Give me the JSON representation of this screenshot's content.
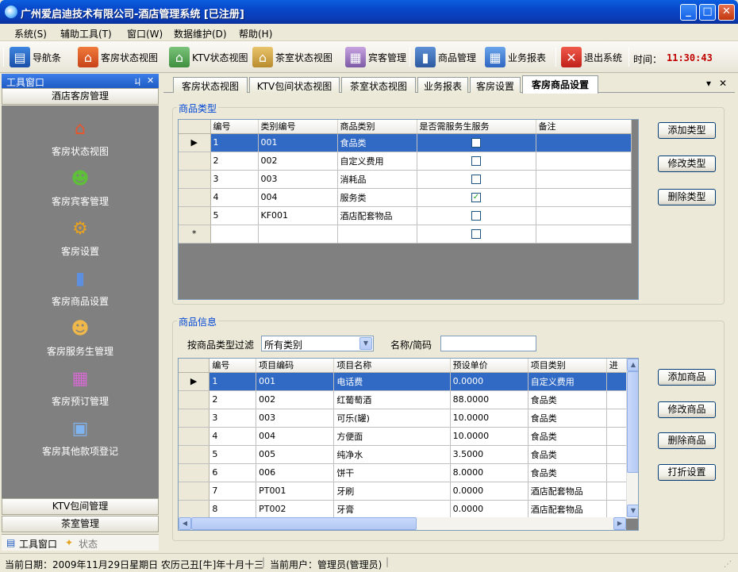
{
  "window": {
    "title": "广州爱启迪技术有限公司-酒店管理系统 [已注册]"
  },
  "menu": [
    "系统(S)",
    "辅助工具(T)",
    "窗口(W)",
    "数据维护(D)",
    "帮助(H)"
  ],
  "toolbar": {
    "items": [
      "导航条",
      "客房状态视图",
      "KTV状态视图",
      "茶室状态视图",
      "宾客管理",
      "商品管理",
      "业务报表",
      "退出系统"
    ],
    "time_label": "时间：",
    "time_value": "11:30:43"
  },
  "left_panel": {
    "title": "工具窗口",
    "pin": "ㄐ",
    "close": "✕",
    "section": "酒店客房管理",
    "nav_items": [
      "客房状态视图",
      "客房宾客管理",
      "客房设置",
      "客房商品设置",
      "客房服务生管理",
      "客房预订管理",
      "客房其他款项登记"
    ],
    "bottom_sections": [
      "KTV包间管理",
      "茶室管理"
    ],
    "bottom_tabs": [
      "工具窗口",
      "状态"
    ]
  },
  "tabs": [
    "客房状态视图",
    "KTV包间状态视图",
    "茶室状态视图",
    "业务报表",
    "客房设置",
    "客房商品设置"
  ],
  "tab_controls": {
    "dropdown": "▾",
    "close": "✕"
  },
  "category_group": {
    "title": "商品类型",
    "columns": [
      "编号",
      "类别编号",
      "商品类别",
      "是否需服务生服务",
      "备注"
    ],
    "rows": [
      {
        "id": "1",
        "code": "001",
        "name": "食品类",
        "service": false,
        "note": ""
      },
      {
        "id": "2",
        "code": "002",
        "name": "自定义费用",
        "service": false,
        "note": ""
      },
      {
        "id": "3",
        "code": "003",
        "name": "消耗品",
        "service": false,
        "note": ""
      },
      {
        "id": "4",
        "code": "004",
        "name": "服务类",
        "service": true,
        "note": ""
      },
      {
        "id": "5",
        "code": "KF001",
        "name": "酒店配套物品",
        "service": false,
        "note": ""
      }
    ],
    "new_row_marker": "*",
    "buttons": [
      "添加类型",
      "修改类型",
      "删除类型"
    ]
  },
  "goods_group": {
    "title": "商品信息",
    "filter_label": "按商品类型过滤",
    "filter_value": "所有类别",
    "name_label": "名称/简码",
    "name_value": "",
    "columns": [
      "编号",
      "项目编码",
      "项目名称",
      "预设单价",
      "项目类别",
      "进"
    ],
    "rows": [
      {
        "id": "1",
        "code": "001",
        "name": "电话费",
        "price": "0.0000",
        "category": "自定义费用"
      },
      {
        "id": "2",
        "code": "002",
        "name": "红葡萄酒",
        "price": "88.0000",
        "category": "食品类"
      },
      {
        "id": "3",
        "code": "003",
        "name": "可乐(罐)",
        "price": "10.0000",
        "category": "食品类"
      },
      {
        "id": "4",
        "code": "004",
        "name": "方便面",
        "price": "10.0000",
        "category": "食品类"
      },
      {
        "id": "5",
        "code": "005",
        "name": "纯净水",
        "price": "3.5000",
        "category": "食品类"
      },
      {
        "id": "6",
        "code": "006",
        "name": "饼干",
        "price": "8.0000",
        "category": "食品类"
      },
      {
        "id": "7",
        "code": "PT001",
        "name": "牙刷",
        "price": "0.0000",
        "category": "酒店配套物品"
      },
      {
        "id": "8",
        "code": "PT002",
        "name": "牙膏",
        "price": "0.0000",
        "category": "酒店配套物品"
      }
    ],
    "buttons": [
      "添加商品",
      "修改商品",
      "删除商品",
      "打折设置"
    ]
  },
  "status_bar": {
    "date": "当前日期：2009年11月29日星期日 农历己丑[牛]年十月十三",
    "user": "当前用户：管理员(管理员)"
  },
  "colors": {
    "selection": "#316ac5",
    "clock": "#c00000",
    "group_title": "#0046d5"
  }
}
